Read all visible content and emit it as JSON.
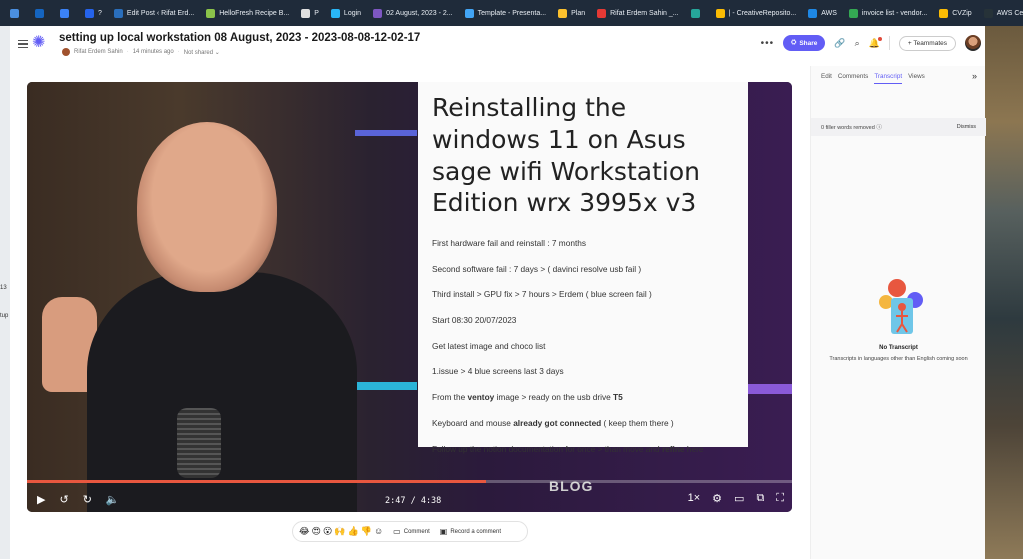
{
  "bookmarks": [
    {
      "label": "",
      "color": "#4a8fe0"
    },
    {
      "label": "",
      "color": "#1565c0"
    },
    {
      "label": "",
      "color": "#3b82f6"
    },
    {
      "label": "?",
      "color": "#2563eb"
    },
    {
      "label": "Edit Post ‹ Rifat Erd...",
      "color": "#2a6ebb"
    },
    {
      "label": "HelloFresh Recipe B...",
      "color": "#8bc34a"
    },
    {
      "label": "P",
      "color": "#e0e0e0"
    },
    {
      "label": "Login",
      "color": "#29b6f6"
    },
    {
      "label": "02 August, 2023 - 2...",
      "color": "#7e57c2"
    },
    {
      "label": "Template - Presenta...",
      "color": "#42a5f5"
    },
    {
      "label": "Plan",
      "color": "#fbc02d"
    },
    {
      "label": "Rifat Erdem Sahin _...",
      "color": "#e53935"
    },
    {
      "label": "",
      "color": "#26a69a"
    },
    {
      "label": "| - CreativeReposito...",
      "color": "#fbbc04"
    },
    {
      "label": "AWS",
      "color": "#1e88e5"
    },
    {
      "label": "invoice list - vendor...",
      "color": "#34a853"
    },
    {
      "label": "CVZip",
      "color": "#fbbc04"
    },
    {
      "label": "AWS Certified Solut...",
      "color": "#263238"
    }
  ],
  "bookmarks_more": "»",
  "header": {
    "title": "setting up local workstation 08 August, 2023 - 2023-08-08-12-02-17",
    "author": "Rifat Erdem Sahin",
    "time_ago": "14 minutes ago",
    "shared_status": "Not shared",
    "more": "•••",
    "share_label": "Share",
    "teammates_label": "+ Teammates"
  },
  "video": {
    "slide": {
      "title": "Reinstalling the windows 11 on Asus sage wifi Workstation Edition wrx 3995x v3",
      "lines": [
        {
          "pre": "First hardware fail and reinstall : 7 months",
          "bold": "",
          "post": "",
          "bold2": "",
          "post2": ""
        },
        {
          "pre": "Second software fail : 7 days > ( davinci resolve usb fail )",
          "bold": "",
          "post": "",
          "bold2": "",
          "post2": ""
        },
        {
          "pre": "Third install > GPU fix > 7 hours > Erdem ( blue screen fail )",
          "bold": "",
          "post": "",
          "bold2": "",
          "post2": ""
        },
        {
          "pre": "Start 08:30 20/07/2023",
          "bold": "",
          "post": "",
          "bold2": "",
          "post2": ""
        },
        {
          "pre": "Get latest image and choco list",
          "bold": "",
          "post": "",
          "bold2": "",
          "post2": ""
        },
        {
          "pre": "1.issue > 4 blue screens last 3 days",
          "bold": "",
          "post": "",
          "bold2": "",
          "post2": ""
        },
        {
          "pre": "From the ",
          "bold": "ventoy",
          "post": " image > ready on the usb drive ",
          "bold2": "T5",
          "post2": ""
        },
        {
          "pre": "Keyboard and mouse ",
          "bold": "already got connected",
          "post": " ( keep them there )",
          "bold2": "",
          "post2": ""
        },
        {
          "pre": "Follow up the notion documentation for once > than move and ",
          "bold": "refine",
          "post": " here",
          "bold2": "",
          "post2": ""
        }
      ]
    },
    "watermark": "BLOG",
    "time": "2:47 / 4:38",
    "progress": 0.6,
    "speed": "1×",
    "progress_color": "#e8573f"
  },
  "reactions": {
    "emojis": [
      "😂",
      "😍",
      "😮",
      "🙌",
      "👍",
      "👎"
    ],
    "comment_label": "Comment",
    "record_label": "Record a comment"
  },
  "panel": {
    "tabs": [
      "Edit",
      "Comments",
      "Transcript",
      "Views"
    ],
    "active_tab": "Transcript",
    "collapse": "»",
    "filler_text": "0 filler words removed ⓘ",
    "dismiss": "Dismiss",
    "empty_title": "No Transcript",
    "empty_sub": "Transcripts in languages other than English coming soon"
  },
  "accent_color": "#625df5"
}
